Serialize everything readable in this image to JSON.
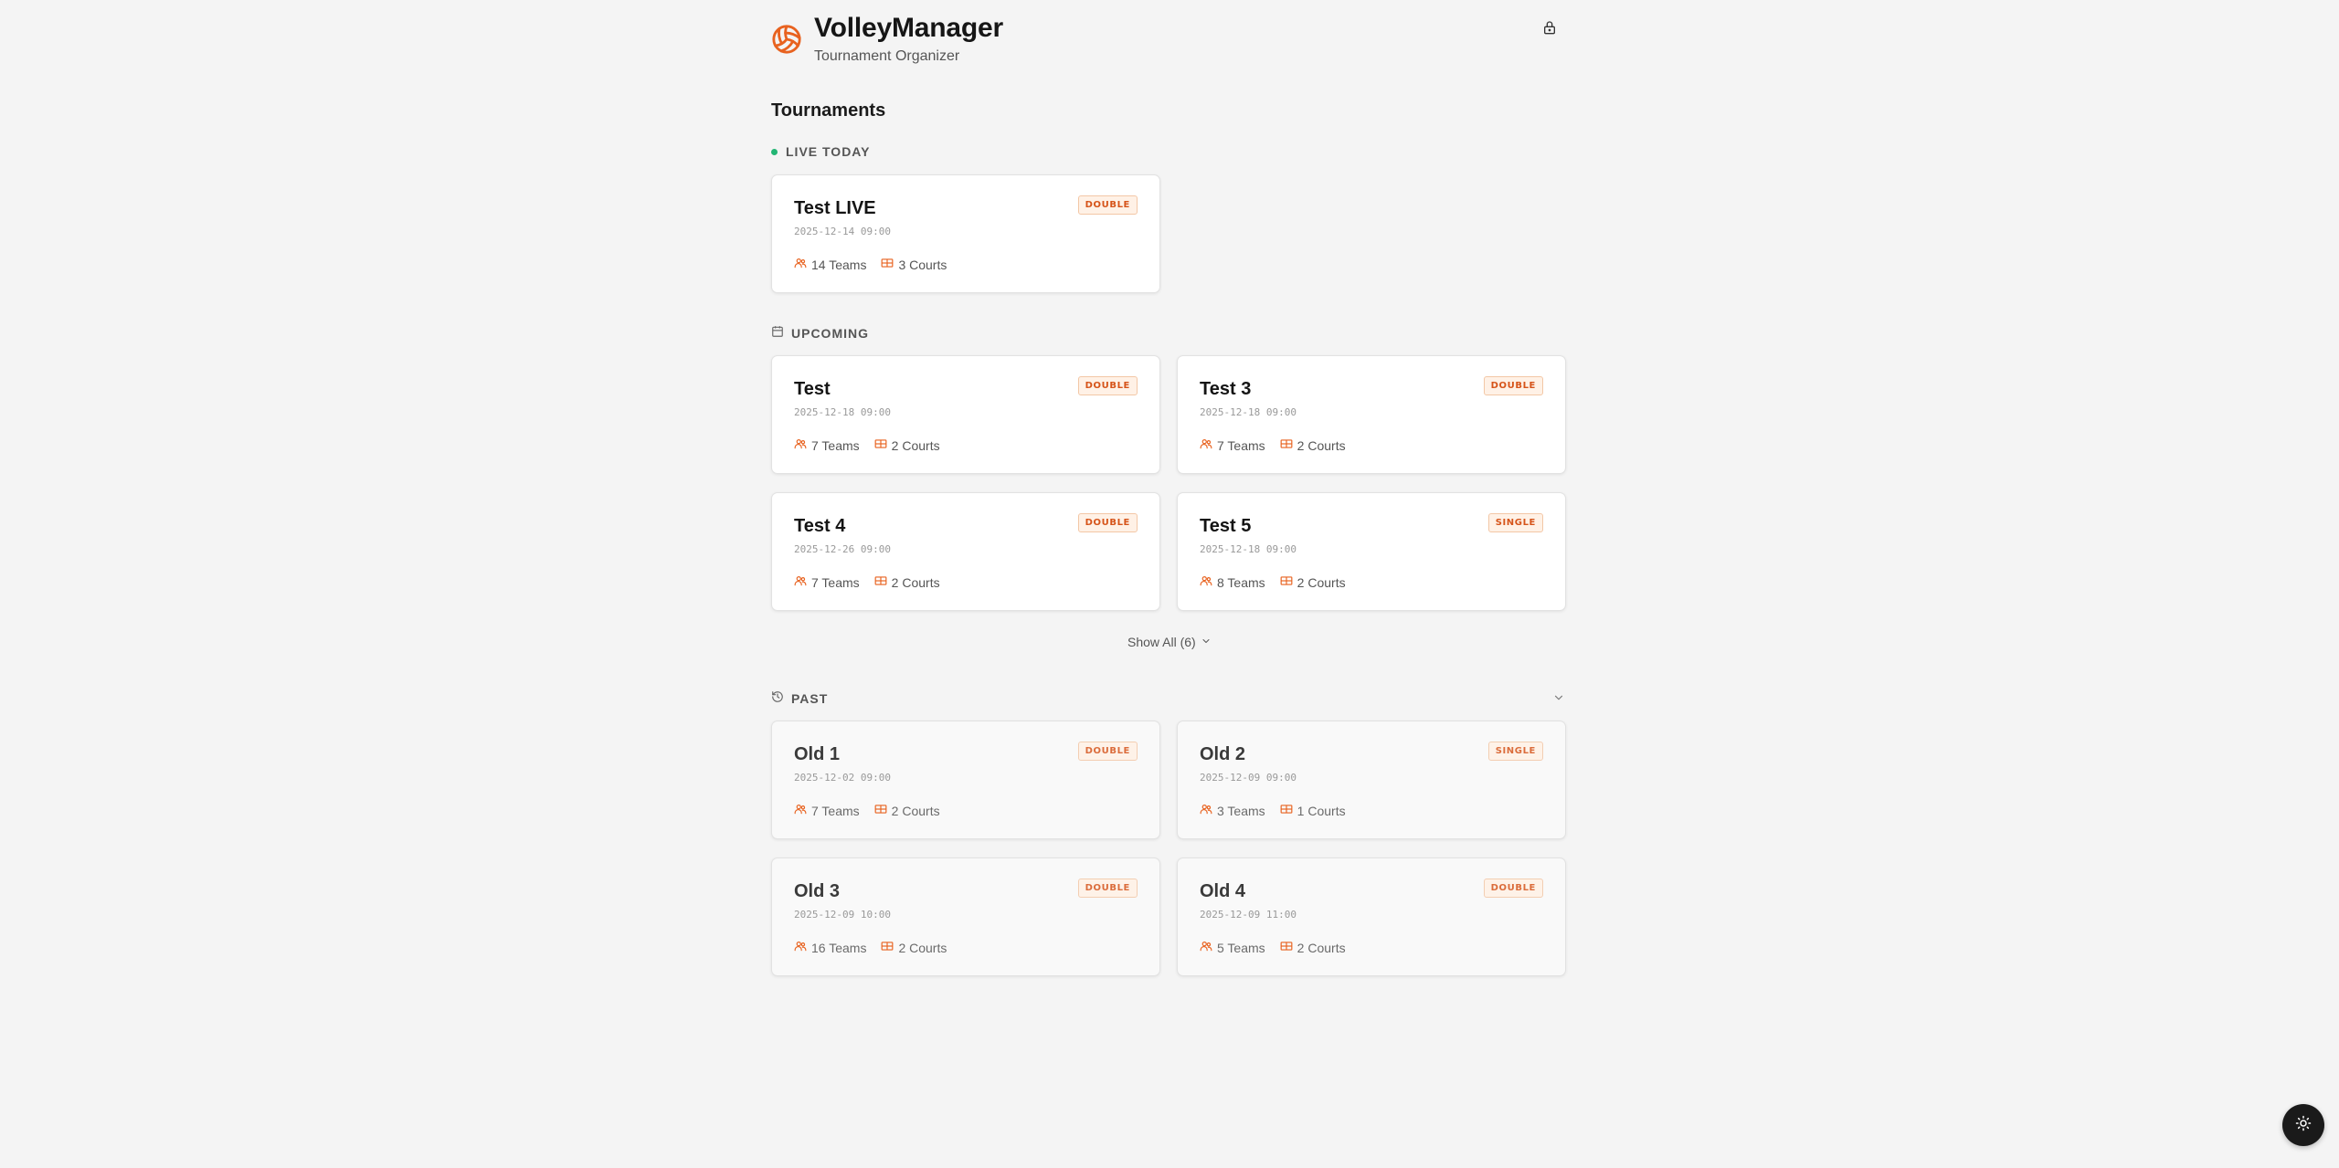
{
  "app": {
    "title": "VolleyManager",
    "subtitle": "Tournament Organizer"
  },
  "page": {
    "title": "Tournaments"
  },
  "sections": {
    "live": {
      "label": "LIVE TODAY"
    },
    "upcoming": {
      "label": "UPCOMING",
      "show_all_label": "Show All (6)"
    },
    "past": {
      "label": "PAST"
    }
  },
  "tournaments": {
    "live": [
      {
        "name": "Test LIVE",
        "date": "2025-12-14 09:00",
        "teams": "14 Teams",
        "courts": "3 Courts",
        "mode": "DOUBLE"
      }
    ],
    "upcoming": [
      {
        "name": "Test",
        "date": "2025-12-18 09:00",
        "teams": "7 Teams",
        "courts": "2 Courts",
        "mode": "DOUBLE"
      },
      {
        "name": "Test 3",
        "date": "2025-12-18 09:00",
        "teams": "7 Teams",
        "courts": "2 Courts",
        "mode": "DOUBLE"
      },
      {
        "name": "Test 4",
        "date": "2025-12-26 09:00",
        "teams": "7 Teams",
        "courts": "2 Courts",
        "mode": "DOUBLE"
      },
      {
        "name": "Test 5",
        "date": "2025-12-18 09:00",
        "teams": "8 Teams",
        "courts": "2 Courts",
        "mode": "SINGLE"
      }
    ],
    "past": [
      {
        "name": "Old 1",
        "date": "2025-12-02 09:00",
        "teams": "7 Teams",
        "courts": "2 Courts",
        "mode": "DOUBLE"
      },
      {
        "name": "Old 2",
        "date": "2025-12-09 09:00",
        "teams": "3 Teams",
        "courts": "1 Courts",
        "mode": "SINGLE"
      },
      {
        "name": "Old 3",
        "date": "2025-12-09 10:00",
        "teams": "16 Teams",
        "courts": "2 Courts",
        "mode": "DOUBLE"
      },
      {
        "name": "Old 4",
        "date": "2025-12-09 11:00",
        "teams": "5 Teams",
        "courts": "2 Courts",
        "mode": "DOUBLE"
      }
    ]
  },
  "icons": {
    "logo": "volleyball-icon",
    "admin": "lock-icon",
    "teams": "users-icon",
    "courts": "court-icon",
    "upcoming": "calendar-icon",
    "past": "history-icon",
    "show_all": "chevron-down-icon",
    "collapse": "chevron-down-icon",
    "theme": "sun-icon"
  },
  "colors": {
    "accent": "#e8621f",
    "live": "#22b573",
    "background": "#f4f4f4"
  }
}
